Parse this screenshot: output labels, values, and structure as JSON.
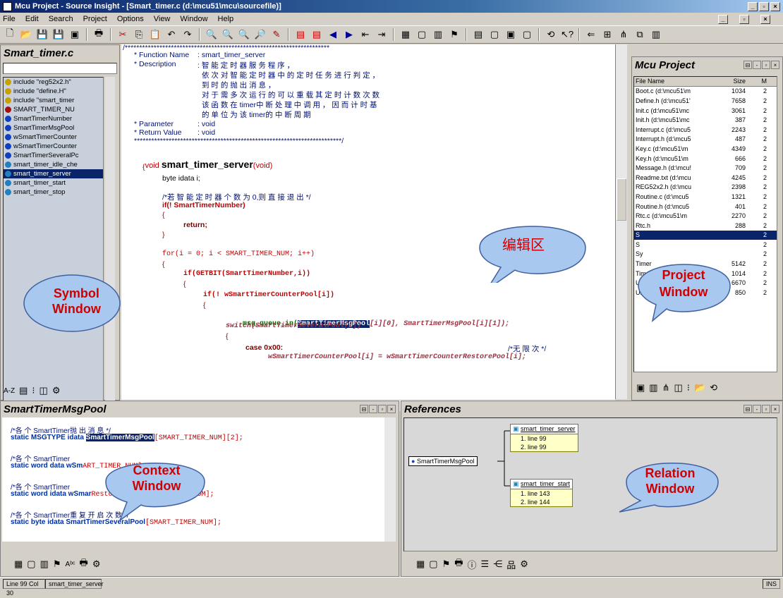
{
  "window": {
    "title": "Mcu Project - Source Insight - [Smart_timer.c (d:\\mcu51\\mcu\\sourcefile)]"
  },
  "menu": [
    "File",
    "Edit",
    "Search",
    "Project",
    "Options",
    "View",
    "Window",
    "Help"
  ],
  "symbol_window": {
    "title": "Smart_timer.c",
    "items": [
      {
        "label": "include \"reg52x2.h\"",
        "color": "#c8a000"
      },
      {
        "label": "include \"define.H\"",
        "color": "#c8a000"
      },
      {
        "label": "include \"smart_timer",
        "color": "#c8a000"
      },
      {
        "label": "SMART_TIMER_NU",
        "color": "#a01010"
      },
      {
        "label": "SmartTimerNumber",
        "color": "#1040c0"
      },
      {
        "label": "SmartTimerMsgPool",
        "color": "#1040c0"
      },
      {
        "label": "wSmartTimerCounter",
        "color": "#1040c0"
      },
      {
        "label": "wSmartTimerCounter",
        "color": "#1040c0"
      },
      {
        "label": "SmartTimerSeveralPc",
        "color": "#1040c0"
      },
      {
        "label": "smart_timer_idle_che",
        "color": "#2080c0"
      },
      {
        "label": "smart_timer_server",
        "color": "#2080c0"
      },
      {
        "label": "smart_timer_start",
        "color": "#2080c0"
      },
      {
        "label": "smart_timer_stop",
        "color": "#2080c0"
      }
    ],
    "callout": [
      "Symbol",
      "Window"
    ]
  },
  "editor": {
    "callout": "编辑区",
    "lines": {
      "stars_top": "/***********************************************************************",
      "fn_name_label": "* Function Name",
      "fn_name_val": ": smart_timer_server",
      "desc_label": "* Description",
      "desc1": ": 智 能 定 时 器 服 务 程 序 ，",
      "desc2": "依 次 对 智 能 定 时 器 中 的 定 时 任 务 进 行 判 定 ，",
      "desc3": "到 时 的 抛 出 消 息 ，",
      "desc4": "对 于 需 多 次 运 行 的 可 以 重 载 其 定 时 计 数 次 数",
      "desc5": "该 函 数 在 timer中 断 处 理 中 调 用 ， 因 而 计 时 基",
      "desc6": "的 单 位 为 该 timer的 中 断 周 期",
      "param_label": "* Parameter",
      "param_val": ": void",
      "ret_label": "* Return Value",
      "ret_val": ": void",
      "stars_bottom": "************************************************************************/",
      "sig_void": "void ",
      "sig_name": "smart_timer_server",
      "sig_args": "(void)",
      "brace_open": "{",
      "decl": "byte idata i;",
      "cmt1": "/*若 智 能 定 时 器 个 数 为 0,则 直 接 退 出 */",
      "if1": "if(! SmartTimerNumber)",
      "brace2": "{",
      "ret": "return;",
      "brace3": "}",
      "for": "for(i = 0; i < SMART_TIMER_NUM; i++)",
      "brace4": "{",
      "if2": "if(GETBIT(SmartTimerNumber,i))",
      "brace5": "{",
      "if3": "if(! wSmartTimerCounterPool[i])",
      "brace6": "{",
      "msg_fn": "msg_queue_in(",
      "msg_hl": "SmartTimerMsgPool",
      "msg_rest": "[i][0], SmartTimerMsgPool[i][1]);",
      "switch": "switch(SmartTimerSeveralPool[i])",
      "brace7": "{",
      "case": "case 0x00:",
      "case_cmt": "/*无 限 次 */",
      "assign": "wSmartTimerCounterPool[i] = wSmartTimerCounterRestorePool[i];"
    }
  },
  "project_window": {
    "title": "Mcu Project",
    "headers": [
      "File Name",
      "Size",
      "M"
    ],
    "rows": [
      [
        "Boot.c (d:\\mcu51\\m",
        "1034",
        "2"
      ],
      [
        "Define.h (d:\\mcu51'",
        "7658",
        "2"
      ],
      [
        "Init.c (d:\\mcu51\\mc",
        "3061",
        "2"
      ],
      [
        "Init.h (d:\\mcu51\\mc",
        "387",
        "2"
      ],
      [
        "Interrupt.c (d:\\mcu5",
        "2243",
        "2"
      ],
      [
        "Interrupt.h (d:\\mcu5",
        "487",
        "2"
      ],
      [
        "Key.c (d:\\mcu51\\m",
        "4349",
        "2"
      ],
      [
        "Key.h (d:\\mcu51\\m",
        "666",
        "2"
      ],
      [
        "Message.h (d:\\mcu!",
        "709",
        "2"
      ],
      [
        "Readme.txt (d:\\mcu",
        "4245",
        "2"
      ],
      [
        "REG52x2.h (d:\\mcu",
        "2398",
        "2"
      ],
      [
        "Routine.c (d:\\mcu5",
        "1321",
        "2"
      ],
      [
        "Routine.h (d:\\mcu5",
        "401",
        "2"
      ],
      [
        "Rtc.c (d:\\mcu51\\m",
        "2270",
        "2"
      ],
      [
        "Rtc.h",
        "288",
        "2"
      ],
      [
        "S",
        "",
        "2"
      ],
      [
        "S",
        "",
        "2"
      ],
      [
        "Sy",
        "",
        "2"
      ],
      [
        "Timer",
        "5142",
        "2"
      ],
      [
        "Timer.h (d:\\mcu51\\",
        "1014",
        "2"
      ],
      [
        "Uart.c (d:\\mcu51\\m",
        "6670",
        "2"
      ],
      [
        "Uart.h (d:\\mcu51\\m",
        "850",
        "2"
      ]
    ],
    "callout": [
      "Project",
      "Window"
    ]
  },
  "context_window": {
    "title": "SmartTimerMsgPool",
    "callout": [
      "Context",
      "Window"
    ],
    "lines": [
      {
        "c": "/*各 个 SmartTimer抛 出 消 息 */",
        "code": "static MSGTYPE idata ",
        "hl": "SmartTimerMsgPool",
        "rest": "[SMART_TIMER_NUM][2];"
      },
      {
        "c": "/*各 个 SmartTimer",
        "code": "static word data wSm",
        "hl": "",
        "rest": "ART_TIMER_NUM];"
      },
      {
        "c": "/*各 个 SmartTimer",
        "code": "static word idata wSmar",
        "hl": "",
        "rest": "RestorePool[SMART_TIMER_NUM];"
      },
      {
        "c": "/*各 个 SmartTimer重 复 开 启 次 数 */",
        "code": "static byte idata SmartTimerSeveralPool",
        "hl": "",
        "rest": "[SMART_TIMER_NUM];"
      }
    ]
  },
  "references": {
    "title": "References",
    "root": "SmartTimerMsgPool",
    "box1": {
      "h": "smart_timer_server",
      "l1": "1. line 99",
      "l2": "2. line 99"
    },
    "box2": {
      "h": "smart_timer_start",
      "l1": "1. line 143",
      "l2": "2. line 144"
    },
    "callout": [
      "Relation",
      "Window"
    ]
  },
  "status": {
    "pos": "Line 99  Col 30",
    "fn": "smart_timer_server",
    "mode": "INS"
  }
}
